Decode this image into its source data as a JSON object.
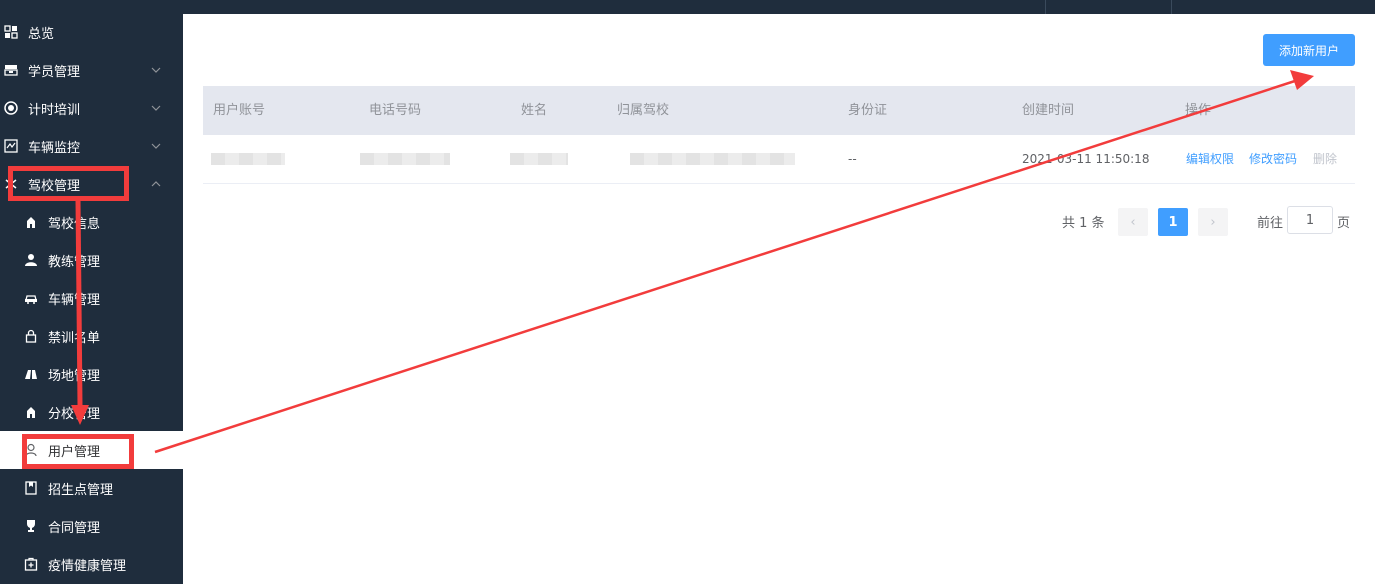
{
  "sidebar": {
    "menu": [
      {
        "label": "总览",
        "icon": "dashboard-icon",
        "chevron": false
      },
      {
        "label": "学员管理",
        "icon": "student-icon",
        "chevron": true
      },
      {
        "label": "计时培训",
        "icon": "clock-icon",
        "chevron": true
      },
      {
        "label": "车辆监控",
        "icon": "monitor-icon",
        "chevron": true
      },
      {
        "label": "驾校管理",
        "icon": "school-icon",
        "chevron": true,
        "expanded": true
      }
    ],
    "sub": [
      {
        "label": "驾校信息",
        "icon": "building-icon"
      },
      {
        "label": "教练管理",
        "icon": "person-icon"
      },
      {
        "label": "车辆管理",
        "icon": "car-icon"
      },
      {
        "label": "禁训名单",
        "icon": "lock-icon"
      },
      {
        "label": "场地管理",
        "icon": "field-icon"
      },
      {
        "label": "分校管理",
        "icon": "branch-icon"
      },
      {
        "label": "用户管理",
        "icon": "user-icon",
        "active": true
      },
      {
        "label": "招生点管理",
        "icon": "bookmark-icon"
      },
      {
        "label": "合同管理",
        "icon": "trophy-icon"
      },
      {
        "label": "疫情健康管理",
        "icon": "medical-icon"
      }
    ]
  },
  "main": {
    "add_button": "添加新用户",
    "table": {
      "headers": [
        "用户账号",
        "电话号码",
        "姓名",
        "归属驾校",
        "身份证",
        "创建时间",
        "操作"
      ],
      "rows": [
        {
          "id_card": "--",
          "created": "2021-03-11 11:50:18",
          "ops": [
            "编辑权限",
            "修改密码",
            "删除"
          ]
        }
      ]
    },
    "pagination": {
      "total": "共 1 条",
      "prev": "‹",
      "current": "1",
      "next": "›",
      "goto_label": "前往",
      "goto_value": "1",
      "page_suffix": "页"
    }
  },
  "colors": {
    "sidebar_bg": "#1f2d3d",
    "accent": "#409eff",
    "header_bg": "#e4e7ef",
    "annotation": "#f23c3c"
  }
}
